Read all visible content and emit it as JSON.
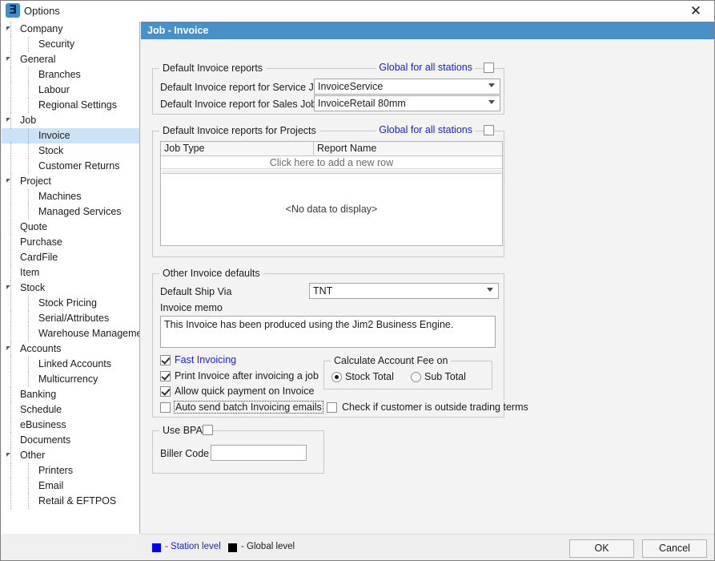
{
  "window": {
    "title": "Options",
    "icon": "app-icon",
    "close_label": "✕"
  },
  "sidebar": {
    "items": [
      {
        "label": "Company",
        "level": 0,
        "expandable": true,
        "selected": false
      },
      {
        "label": "Security",
        "level": 1,
        "expandable": false,
        "selected": false
      },
      {
        "label": "General",
        "level": 0,
        "expandable": true,
        "selected": false
      },
      {
        "label": "Branches",
        "level": 1,
        "expandable": false,
        "selected": false
      },
      {
        "label": "Labour",
        "level": 1,
        "expandable": false,
        "selected": false
      },
      {
        "label": "Regional Settings",
        "level": 1,
        "expandable": false,
        "selected": false
      },
      {
        "label": "Job",
        "level": 0,
        "expandable": true,
        "selected": false
      },
      {
        "label": "Invoice",
        "level": 1,
        "expandable": false,
        "selected": true
      },
      {
        "label": "Stock",
        "level": 1,
        "expandable": false,
        "selected": false
      },
      {
        "label": "Customer Returns",
        "level": 1,
        "expandable": false,
        "selected": false
      },
      {
        "label": "Project",
        "level": 0,
        "expandable": true,
        "selected": false
      },
      {
        "label": "Machines",
        "level": 1,
        "expandable": false,
        "selected": false
      },
      {
        "label": "Managed Services",
        "level": 1,
        "expandable": false,
        "selected": false
      },
      {
        "label": "Quote",
        "level": 0,
        "expandable": false,
        "selected": false
      },
      {
        "label": "Purchase",
        "level": 0,
        "expandable": false,
        "selected": false
      },
      {
        "label": "CardFile",
        "level": 0,
        "expandable": false,
        "selected": false
      },
      {
        "label": "Item",
        "level": 0,
        "expandable": false,
        "selected": false
      },
      {
        "label": "Stock",
        "level": 0,
        "expandable": true,
        "selected": false
      },
      {
        "label": "Stock Pricing",
        "level": 1,
        "expandable": false,
        "selected": false
      },
      {
        "label": "Serial/Attributes",
        "level": 1,
        "expandable": false,
        "selected": false
      },
      {
        "label": "Warehouse Management",
        "level": 1,
        "expandable": false,
        "selected": false
      },
      {
        "label": "Accounts",
        "level": 0,
        "expandable": true,
        "selected": false
      },
      {
        "label": "Linked Accounts",
        "level": 1,
        "expandable": false,
        "selected": false
      },
      {
        "label": "Multicurrency",
        "level": 1,
        "expandable": false,
        "selected": false
      },
      {
        "label": "Banking",
        "level": 0,
        "expandable": false,
        "selected": false
      },
      {
        "label": "Schedule",
        "level": 0,
        "expandable": false,
        "selected": false
      },
      {
        "label": "eBusiness",
        "level": 0,
        "expandable": false,
        "selected": false
      },
      {
        "label": "Documents",
        "level": 0,
        "expandable": false,
        "selected": false
      },
      {
        "label": "Other",
        "level": 0,
        "expandable": true,
        "selected": false
      },
      {
        "label": "Printers",
        "level": 1,
        "expandable": false,
        "selected": false
      },
      {
        "label": "Email",
        "level": 1,
        "expandable": false,
        "selected": false
      },
      {
        "label": "Retail & EFTPOS",
        "level": 1,
        "expandable": false,
        "selected": false
      }
    ]
  },
  "pane": {
    "header": "Job - Invoice"
  },
  "default_reports": {
    "group_title": "Default Invoice reports",
    "global_label": "Global for all stations",
    "global_checked": false,
    "service_label": "Default Invoice report for Service Job",
    "service_value": "InvoiceService",
    "sales_label": "Default Invoice report for Sales Job",
    "sales_value": "InvoiceRetail 80mm"
  },
  "project_reports": {
    "group_title": "Default Invoice reports for Projects",
    "global_label": "Global for all stations",
    "global_checked": false,
    "columns": [
      "Job Type",
      "Report Name"
    ],
    "new_row_text": "Click here to add a new row",
    "empty_text": "<No data to display>",
    "rows": []
  },
  "other_defaults": {
    "group_title": "Other Invoice defaults",
    "ship_via_label": "Default Ship Via",
    "ship_via_value": "TNT",
    "memo_label": "Invoice memo",
    "memo_value": "This Invoice has been produced using the Jim2 Business Engine.",
    "checkboxes": [
      {
        "label": "Fast Invoicing",
        "checked": true,
        "blue": true,
        "focused": false
      },
      {
        "label": "Print Invoice after invoicing a job",
        "checked": true,
        "blue": false,
        "focused": false
      },
      {
        "label": "Allow quick payment on Invoice",
        "checked": true,
        "blue": false,
        "focused": false
      },
      {
        "label": "Auto send batch Invoicing emails",
        "checked": false,
        "blue": false,
        "focused": true
      }
    ],
    "account_fee": {
      "group_title": "Calculate Account Fee on",
      "options": [
        {
          "label": "Stock Total",
          "checked": true
        },
        {
          "label": "Sub Total",
          "checked": false
        }
      ]
    },
    "trading_terms": {
      "label": "Check if customer is outside trading terms",
      "checked": false
    }
  },
  "bpay": {
    "group_title": "Use BPAY",
    "use_bpay_checked": false,
    "biller_code_label": "Biller Code",
    "biller_code_value": ""
  },
  "footer": {
    "station_level_text": "- Station level",
    "station_level_color": "#0000ff",
    "global_level_text": "- Global level",
    "global_level_color": "#000000",
    "ok_label": "OK",
    "cancel_label": "Cancel"
  }
}
